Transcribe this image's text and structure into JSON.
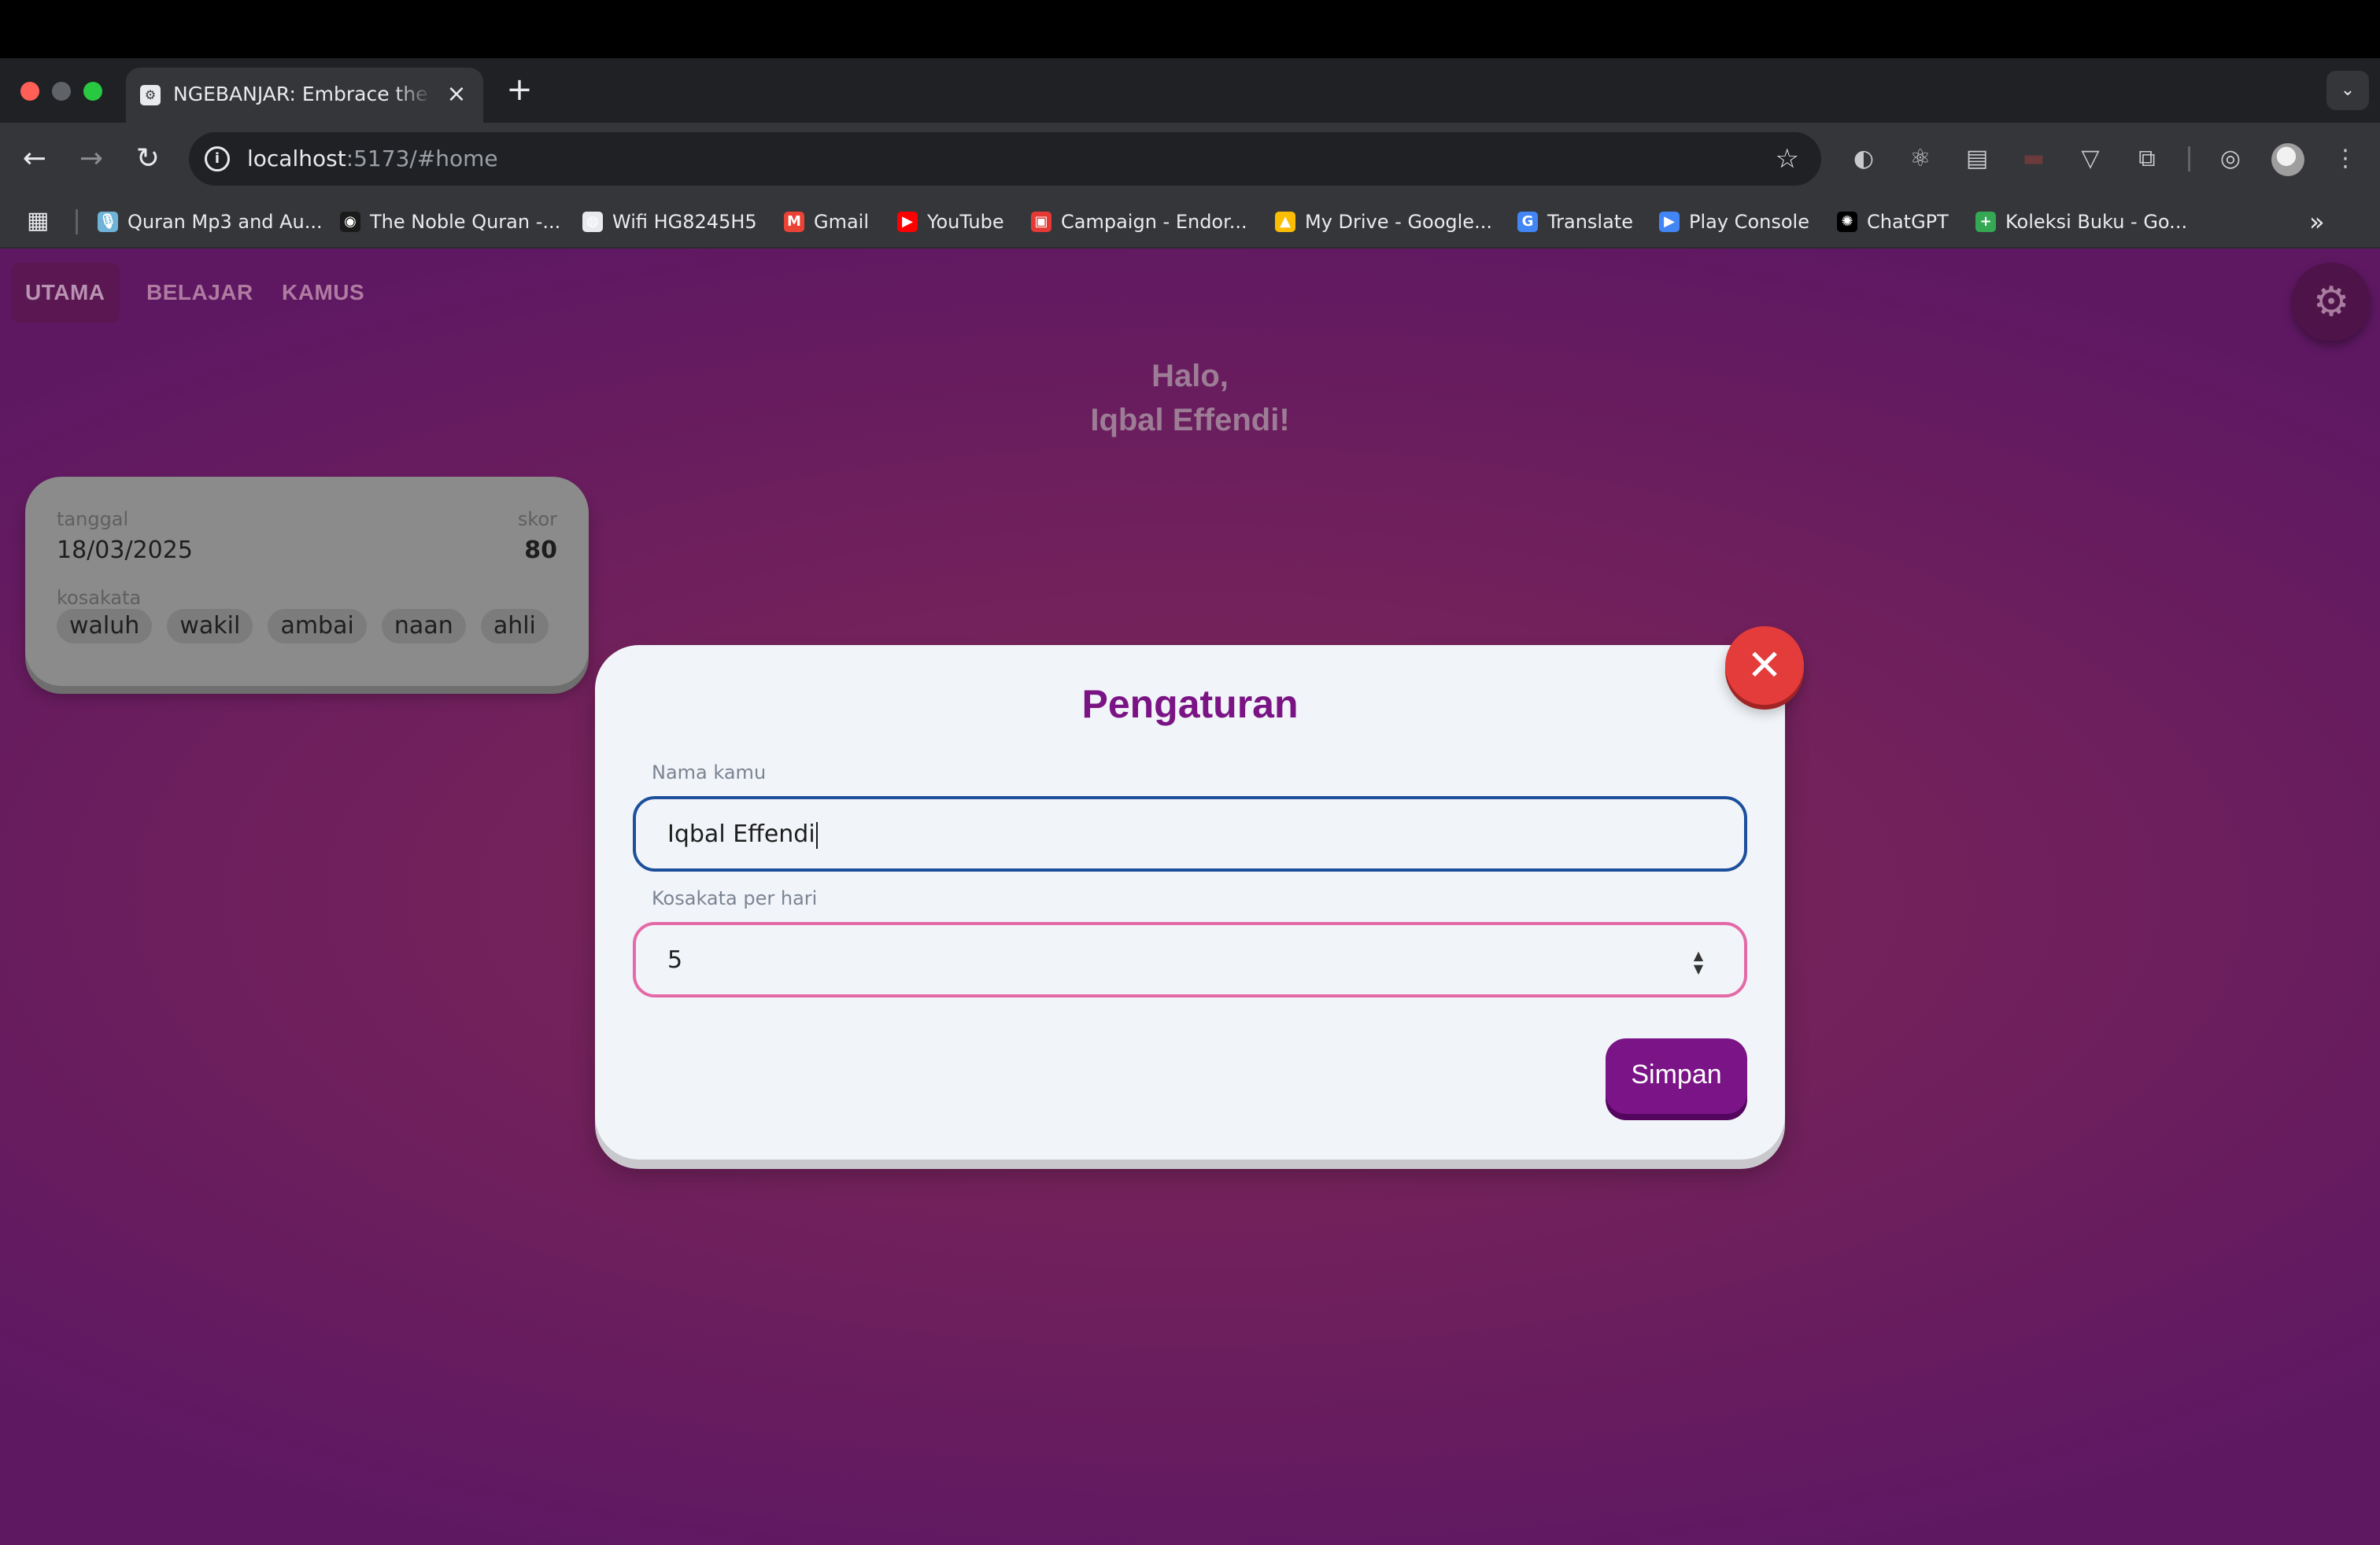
{
  "browser": {
    "tab_title": "NGEBANJAR: Embrace the Be",
    "url_host": "localhost",
    "url_path": ":5173/#home",
    "bookmarks": [
      {
        "label": "Quran Mp3 and Au...",
        "icon": "microphone-icon",
        "color": "#6fb4d8"
      },
      {
        "label": "The Noble Quran -...",
        "icon": "quran-icon",
        "color": "#1a1a1a"
      },
      {
        "label": "Wifi HG8245H5",
        "icon": "globe-icon",
        "color": "#e8eaed"
      },
      {
        "label": "Gmail",
        "icon": "gmail-icon",
        "color": "#ea4335"
      },
      {
        "label": "YouTube",
        "icon": "youtube-icon",
        "color": "#ff0000"
      },
      {
        "label": "Campaign - Endor...",
        "icon": "campaign-icon",
        "color": "#e53935"
      },
      {
        "label": "My Drive - Google...",
        "icon": "drive-icon",
        "color": "#fbbc04"
      },
      {
        "label": "Translate",
        "icon": "translate-icon",
        "color": "#4285f4"
      },
      {
        "label": "Play Console",
        "icon": "play-console-icon",
        "color": "#4285f4"
      },
      {
        "label": "ChatGPT",
        "icon": "chatgpt-icon",
        "color": "#000000"
      },
      {
        "label": "Koleksi Buku - Go...",
        "icon": "sheets-icon",
        "color": "#34a853"
      }
    ]
  },
  "app": {
    "nav": [
      {
        "label": "UTAMA",
        "active": true
      },
      {
        "label": "BELAJAR",
        "active": false
      },
      {
        "label": "KAMUS",
        "active": false
      }
    ],
    "greeting_line1": "Halo,",
    "greeting_line2": "Iqbal Effendi!",
    "history_card": {
      "date_label": "tanggal",
      "date_value": "18/03/2025",
      "score_label": "skor",
      "score_value": "80",
      "vocab_label": "kosakata",
      "words": [
        "waluh",
        "wakil",
        "ambai",
        "naan",
        "ahli"
      ]
    }
  },
  "modal": {
    "title": "Pengaturan",
    "name_label": "Nama kamu",
    "name_value": "Iqbal Effendi",
    "qty_label": "Kosakata per hari",
    "qty_value": "5",
    "save_label": "Simpan"
  },
  "colors": {
    "brand": "#7b1487",
    "close": "#e43b3b",
    "input_focus": "#1d4f9c",
    "input_accent": "#e46aa7"
  }
}
